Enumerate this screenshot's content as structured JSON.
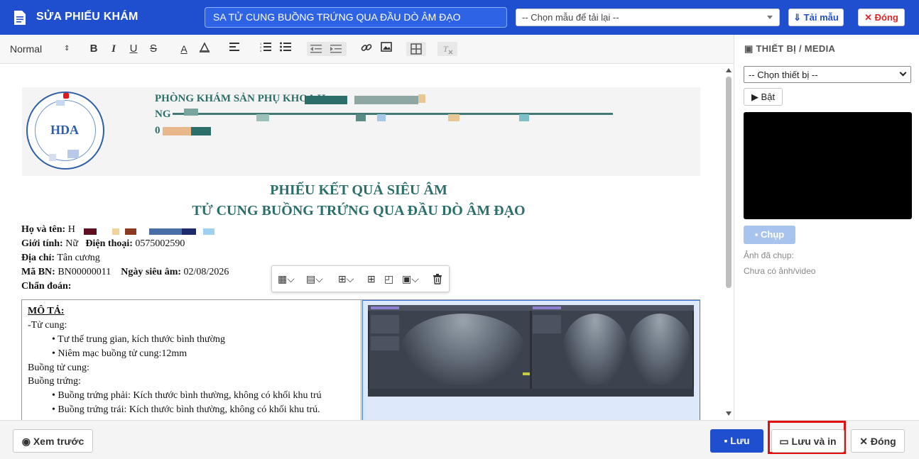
{
  "header": {
    "title": "SỬA PHIẾU KHÁM",
    "record_title": "SA TỬ CUNG BUỒNG TRỨNG QUA ĐẦU DÒ ÂM ĐẠO",
    "template_select": "-- Chọn mẫu để tải lại --",
    "load_template_label": "⇓ Tải mẫu",
    "close_label": "✕ Đóng",
    "brand_color": "#1f4fcf"
  },
  "toolbar": {
    "paragraph_style": "Normal",
    "bold": "B",
    "italic": "I",
    "underline": "U",
    "strike": "S",
    "font_color": "A"
  },
  "document": {
    "clinic_name": "PHÒNG KHÁM SẢN PHỤ KHOA H",
    "clinic_address": "NG",
    "clinic_phone": "0",
    "logo_text": "HDA",
    "title_line1": "PHIẾU KẾT QUẢ SIÊU ÂM",
    "title_line2": "TỬ CUNG BUỒNG TRỨNG QUA ĐẦU DÒ ÂM ĐẠO",
    "patient": {
      "name_label": "Họ và tên:",
      "name_value": "H",
      "gender_label": "Giới tính:",
      "gender_value": "Nữ",
      "phone_label": "Điện thoại:",
      "phone_value": "0575002590",
      "address_label": "Địa chỉ:",
      "address_value": "Tân cương",
      "code_label": "Mã BN:",
      "code_value": "BN00000011",
      "date_label": "Ngày siêu âm:",
      "date_value": "02/08/2026",
      "diagnosis_label": "Chẩn đoán:"
    },
    "description": {
      "heading": "MÔ TẢ:",
      "lines": [
        "-Tử cung:",
        "• Tư thế trung gian, kích thước bình thường",
        "• Niêm mạc buồng tử cung:12mm",
        "Buồng tử cung:",
        "Buồng trứng:",
        "• Buồng trứng phải: Kích thước bình thường, không có khối khu trú",
        "• Buồng trứng trái: Kích thước bình thường, không có khối khu trú."
      ]
    }
  },
  "right_panel": {
    "title": "THIẾT BỊ / MEDIA",
    "device_select": "-- Chọn thiết bị --",
    "turn_on_label": "▶ Bật",
    "capture_label": "Chụp",
    "captured_label": "Ảnh đã chụp:",
    "empty_label": "Chưa có ảnh/video"
  },
  "footer": {
    "preview_label": "Xem trước",
    "save_label": "Lưu",
    "save_print_label": "Lưu và in",
    "close_label": "✕ Đóng"
  }
}
